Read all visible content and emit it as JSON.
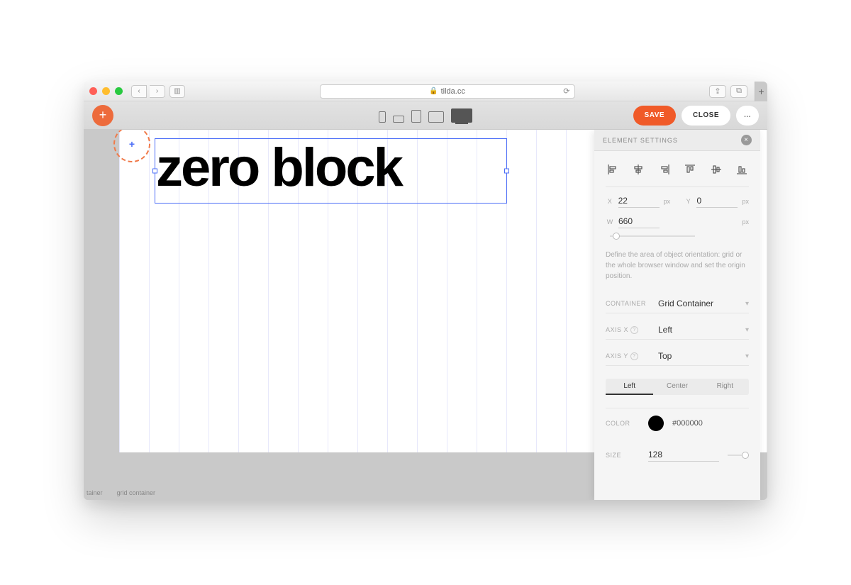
{
  "browser": {
    "url": "tilda.cc"
  },
  "toolbar": {
    "save": "SAVE",
    "close": "CLOSE",
    "more": "..."
  },
  "canvas": {
    "text": "zero block"
  },
  "footer": {
    "tainer": "tainer",
    "grid_container": "grid container"
  },
  "panel": {
    "title": "ELEMENT SETTINGS",
    "position": {
      "x_label": "X",
      "x_value": "22",
      "x_unit": "px",
      "y_label": "Y",
      "y_value": "0",
      "y_unit": "px",
      "w_label": "W",
      "w_value": "660",
      "w_unit": "px"
    },
    "help": "Define the area of object orientation: grid or the whole browser window and set the origin position.",
    "container": {
      "label": "CONTAINER",
      "value": "Grid Container"
    },
    "axis_x": {
      "label": "AXIS X",
      "value": "Left"
    },
    "axis_y": {
      "label": "AXIS Y",
      "value": "Top"
    },
    "align_seg": {
      "left": "Left",
      "center": "Center",
      "right": "Right"
    },
    "color": {
      "label": "COLOR",
      "value": "#000000"
    },
    "size": {
      "label": "SIZE",
      "value": "128"
    }
  }
}
